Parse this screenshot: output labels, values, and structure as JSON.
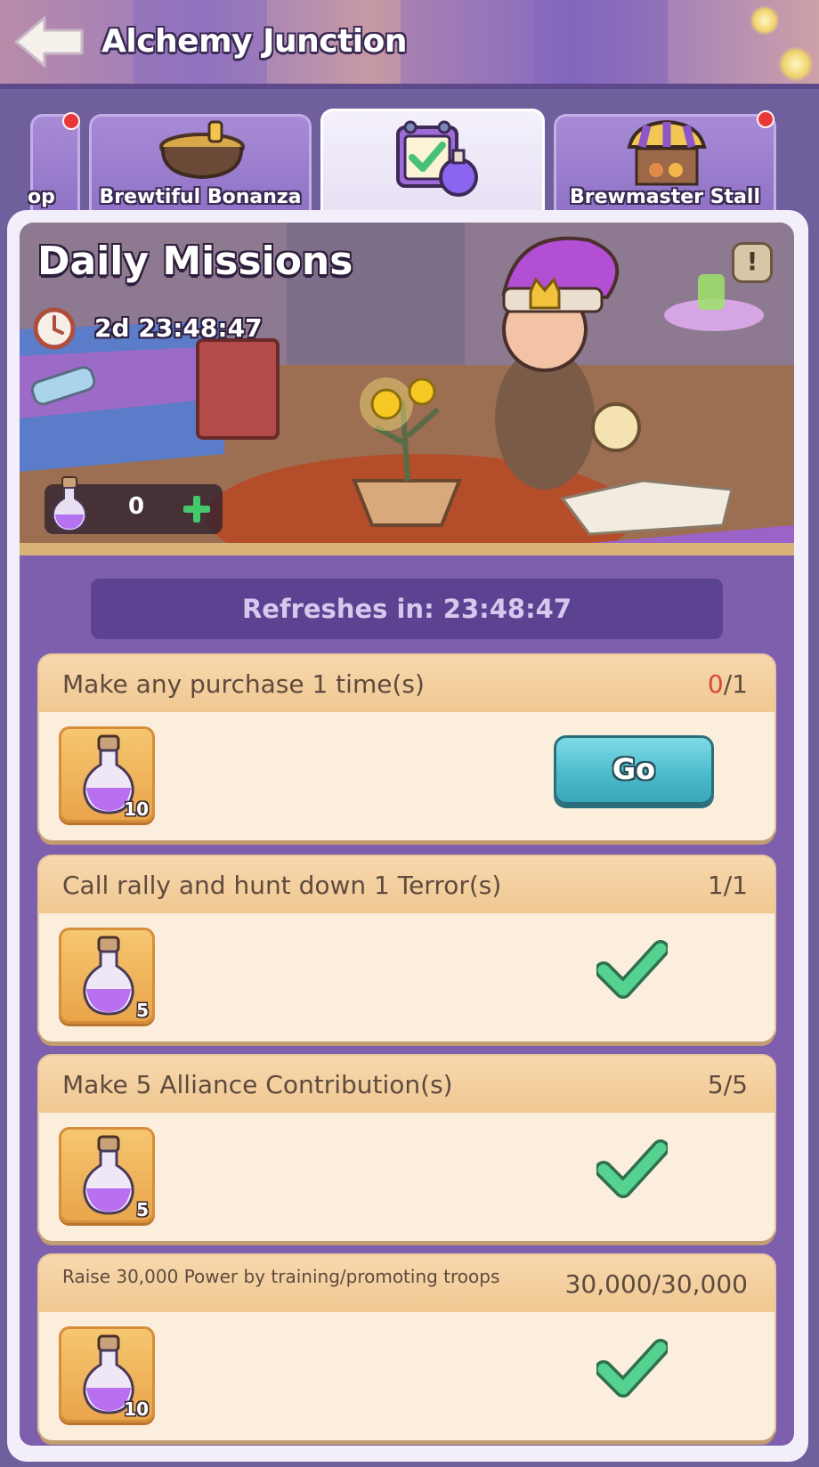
{
  "header": {
    "title": "Alchemy Junction"
  },
  "tabs": [
    {
      "label": "op",
      "has_notification": true
    },
    {
      "label": "Brewtiful Bonanza",
      "has_notification": false
    },
    {
      "label": "",
      "has_notification": false,
      "active": true
    },
    {
      "label": "Brewmaster Stall",
      "has_notification": true
    }
  ],
  "banner": {
    "title": "Daily Missions",
    "timer": "2d 23:48:47",
    "potion_count": "0",
    "info_label": "!"
  },
  "missions_panel": {
    "refresh_text": "Refreshes in: 23:48:47",
    "missions": [
      {
        "title": "Make any purchase 1 time(s)",
        "progress_current": "0",
        "progress_total": "/1",
        "reward_qty": "10",
        "action": "Go"
      },
      {
        "title": "Call rally and hunt down 1 Terror(s)",
        "progress_current": "1",
        "progress_total": "/1",
        "reward_qty": "5",
        "action": "done"
      },
      {
        "title": "Make 5 Alliance Contribution(s)",
        "progress_current": "5",
        "progress_total": "/5",
        "reward_qty": "5",
        "action": "done"
      },
      {
        "title": "Raise 30,000 Power by training/promoting troops",
        "progress_current": "30,000",
        "progress_total": "/30,000",
        "reward_qty": "10",
        "action": "done"
      }
    ]
  },
  "colors": {
    "accent_purple": "#7d5fae",
    "go_button": "#4cbccd",
    "check_green": "#4fc98a",
    "progress_incomplete": "#d9483a"
  }
}
